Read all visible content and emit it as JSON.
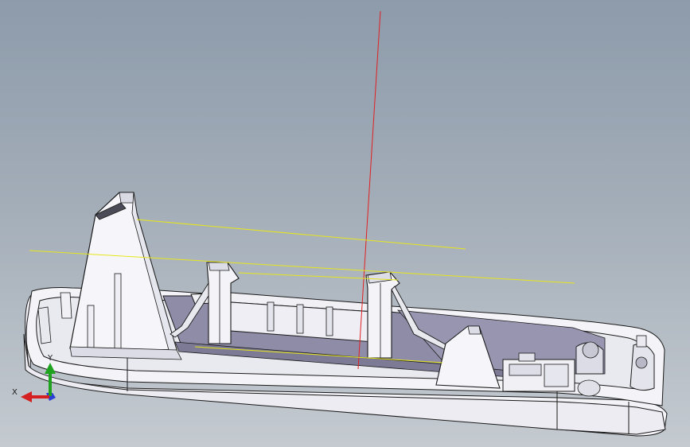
{
  "triad": {
    "x_label": "X",
    "y_label": "Y",
    "x_color": "#d42020",
    "y_color": "#1fa31f",
    "z_color": "#2a3fd6"
  },
  "colors": {
    "background_top": "#8d9bab",
    "background_bottom": "#c4cad0",
    "model_body": "#f2f2f7",
    "model_edge": "#1a1a1a",
    "model_interior": "#8f8ca8",
    "sketch_vertical": "#e02020",
    "sketch_horizontal": "#e6e61a"
  }
}
